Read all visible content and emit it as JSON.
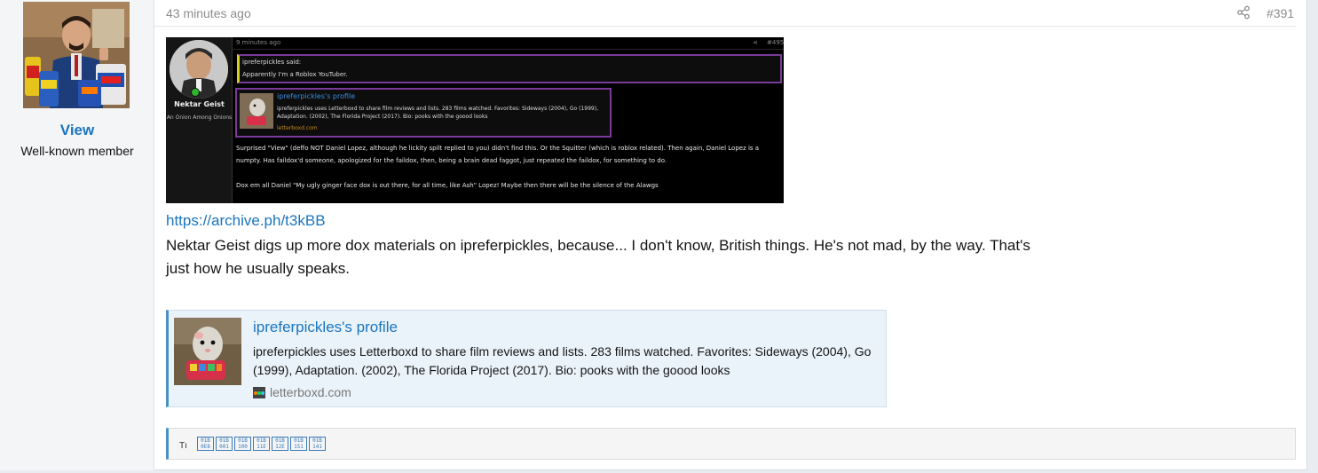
{
  "user": {
    "name": "View",
    "title": "Well-known member"
  },
  "post": {
    "time": "43 minutes ago",
    "number": "#391",
    "link": "https://archive.ph/t3kBB",
    "text": "Nektar Geist digs up more dox materials on ipreferpickles, because... I don't know, British things. He's not mad, by the way. That's just how he usually speaks."
  },
  "embedded_shot": {
    "time": "9 minutes ago",
    "number": "#495",
    "user_name": "Nektar Geist",
    "user_title": "An Onion Among Onions",
    "quote_author": "ipreferpickles said:",
    "quote_text": "Apparently I'm a Roblox YouTuber.",
    "card_title": "ipreferpickles's profile",
    "card_desc": "ipreferpickles uses Letterboxd to share film reviews and lists. 283 films watched. Favorites: Sideways (2004), Go (1999), Adaptation. (2002), The Florida Project (2017). Bio: pooks with the goood looks",
    "card_domain": "letterboxd.com",
    "body_1": "Surprised \"View\" (deffo NOT Daniel Lopez, although he lickity spilt replied to you) didn't find this. Or the Squitter (which is roblox related). Then again, Daniel Lopez is a numpty. Has faildox'd someone, apologized for the faildox, then, being a brain dead faggot, just repeated the faildox, for something to do.",
    "body_2": "Dox em all Daniel \"My ugly ginger face dox is out there, for all time, like Ash\" Lopez! Maybe then there will be the silence of the Alawgs"
  },
  "unfurl": {
    "title": "ipreferpickles's profile",
    "description": "ipreferpickles uses Letterboxd to share film reviews and lists. 283 films watched. Favorites: Sideways (2004), Go (1999), Adaptation. (2002), The Florida Project (2017). Bio: pooks with the goood looks",
    "domain": "letterboxd.com"
  },
  "signature": {
    "label": "Tı",
    "glyphs": [
      [
        "01B",
        "0E8"
      ],
      [
        "01B",
        "001"
      ],
      [
        "01B",
        "100"
      ],
      [
        "01B",
        "11E"
      ],
      [
        "01B",
        "12E"
      ],
      [
        "01B",
        "151"
      ],
      [
        "01B",
        "141"
      ]
    ]
  },
  "icons": {
    "share": "share-icon",
    "favicon": "letterboxd-favicon"
  },
  "colors": {
    "link": "#1a75c0",
    "accent": "#4a90c8",
    "unfurl_bg": "#eaf3fa"
  }
}
